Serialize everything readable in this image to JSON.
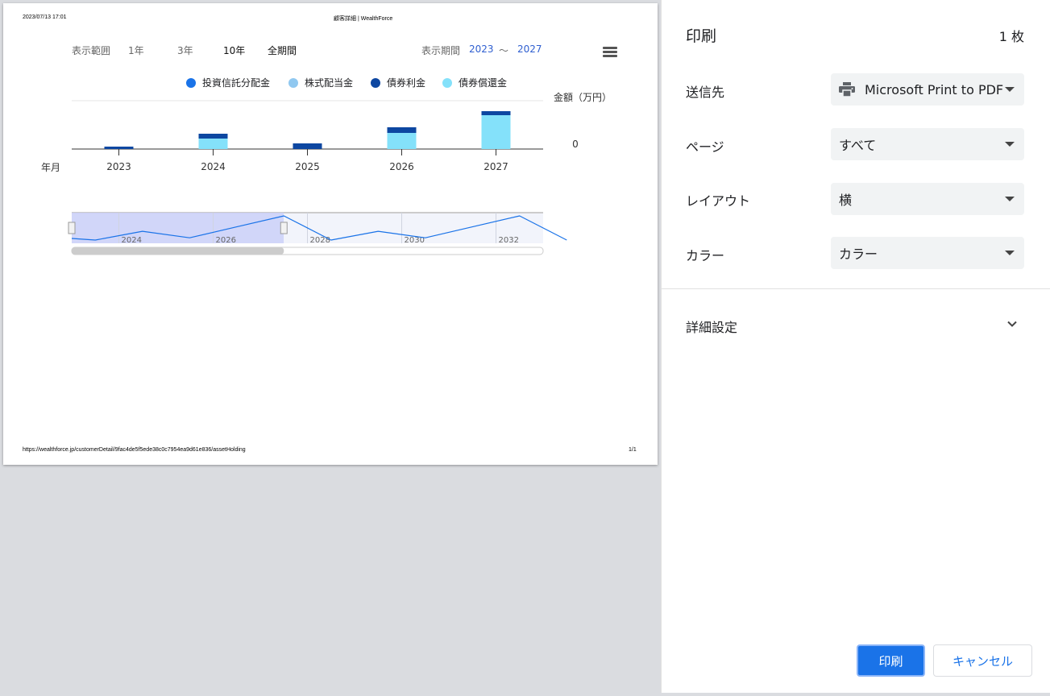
{
  "page_header": {
    "datetime": "2023/07/13 17:01",
    "title": "顧客詳細 | WealthForce"
  },
  "page_footer": {
    "url": "https://wealthforce.jp/customerDetail/9fac4de5f5ede38c0c7954ea9d61e836/assetHolding",
    "page_number": "1/1"
  },
  "range_controls": {
    "label": "表示範囲",
    "options": [
      "1年",
      "3年",
      "10年",
      "全期間"
    ],
    "period_label": "表示期間",
    "period_from": "2023",
    "period_sep": "〜",
    "period_to": "2027"
  },
  "icons": {
    "menu": "hamburger-menu-icon",
    "printer": "printer-icon",
    "more": "chevron-down-icon"
  },
  "chart_data": {
    "type": "bar",
    "stacked": true,
    "categories": [
      "2023",
      "2024",
      "2025",
      "2026",
      "2027"
    ],
    "series": [
      {
        "name": "投資信託分配金",
        "color": "#1a73e8",
        "values": [
          0,
          0,
          0,
          0,
          0
        ]
      },
      {
        "name": "株式配当金",
        "color": "#90c8f0",
        "values": [
          0,
          0,
          0,
          0,
          0
        ]
      },
      {
        "name": "債券利金",
        "color": "#0d47a1",
        "values": [
          3,
          6,
          7,
          7,
          5
        ]
      },
      {
        "name": "債券償還金",
        "color": "#84e1fa",
        "values": [
          0,
          13,
          0,
          20,
          42
        ]
      }
    ],
    "ylabel": "金額（万円）",
    "xlabel": "年月",
    "ytick": "0",
    "ylim": [
      0,
      60
    ],
    "navigator": {
      "ticks": [
        "2024",
        "2026",
        "2028",
        "2030",
        "2032"
      ],
      "selected_range": [
        "2023",
        "2027"
      ]
    }
  },
  "panel": {
    "title": "印刷",
    "sheet_count": "1 枚",
    "destination_label": "送信先",
    "destination_value": "Microsoft Print to PDF",
    "pages_label": "ページ",
    "pages_value": "すべて",
    "layout_label": "レイアウト",
    "layout_value": "横",
    "color_label": "カラー",
    "color_value": "カラー",
    "more_settings_label": "詳細設定",
    "print_button": "印刷",
    "cancel_button": "キャンセル"
  },
  "colors": {
    "accent": "#1a73e8",
    "period_blue": "#2f5fd0",
    "navigator_selection": "#c9cff8"
  }
}
